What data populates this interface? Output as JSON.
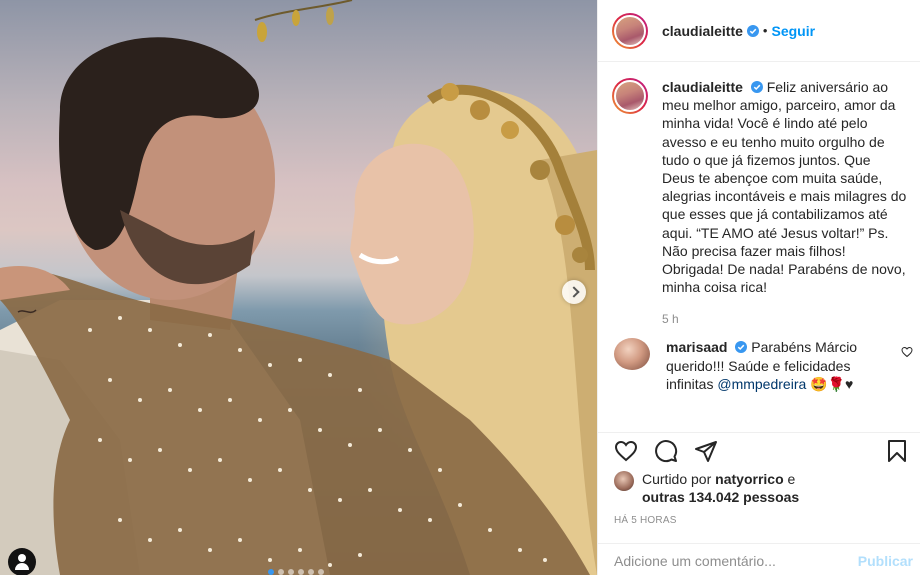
{
  "post": {
    "author": "claudialeitte",
    "follow_label": "Seguir",
    "separator": "•",
    "caption_author": "claudialeitte",
    "caption": "Feliz aniversário ao meu melhor amigo, parceiro, amor da minha vida! Você é lindo até pelo avesso e eu tenho muito orgulho de tudo o que já fizemos juntos. Que Deus te abençoe com muita saúde, alegrias incontáveis e mais milagres do que esses que já contabilizamos até aqui. “TE AMO até Jesus voltar!” Ps. Não precisa fazer mais filhos! Obrigada! De nada! Parabéns de novo, minha coisa rica!",
    "caption_time": "5 h"
  },
  "comment": {
    "author": "marisaad",
    "text": "Parabéns Márcio querido!!! Saúde e felicidades infinitas",
    "mention": "@mmpedreira",
    "emoji": "🤩🌹♥"
  },
  "likes": {
    "prefix": "Curtido por",
    "user": "natyorrico",
    "middle": "e",
    "others": "outras 134.042 pessoas"
  },
  "posted_ago": "HÁ 5 HORAS",
  "comment_box": {
    "placeholder": "Adicione um comentário...",
    "publish_label": "Publicar"
  },
  "carousel": {
    "slides": 6,
    "active": 1
  },
  "icons": [
    "verified-badge-icon",
    "heart-icon",
    "comment-icon",
    "share-icon",
    "bookmark-icon",
    "chevron-right-icon",
    "user-tag-icon"
  ],
  "colors": {
    "accent": "#0095f6",
    "verified": "#3897f0",
    "muted": "#8e8e8e",
    "mention": "#00376b"
  }
}
